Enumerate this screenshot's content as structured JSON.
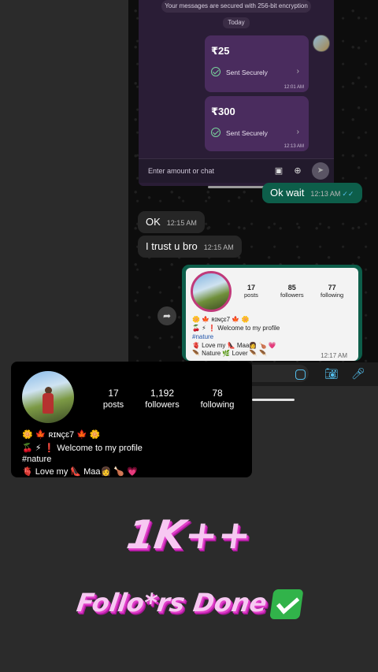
{
  "chat": {
    "encryption_notice": "Your messages are secured with 256-bit encryption",
    "date_label": "Today",
    "payments": [
      {
        "amount": "₹25",
        "status": "Sent Securely",
        "time": "12:01 AM"
      },
      {
        "amount": "₹300",
        "status": "Sent Securely",
        "time": "12:13 AM"
      }
    ],
    "amount_placeholder": "Enter amount or chat",
    "messages": [
      {
        "text": "Ok wait",
        "time": "12:13 AM",
        "direction": "outgoing"
      },
      {
        "text": "OK",
        "time": "12:15 AM",
        "direction": "incoming"
      },
      {
        "text": "I trust u bro",
        "time": "12:15 AM",
        "direction": "incoming"
      }
    ],
    "shared_profile": {
      "posts": "17",
      "posts_label": "posts",
      "followers": "85",
      "followers_label": "followers",
      "following": "77",
      "following_label": "following",
      "bio_line1": "🌼 🍁 ʀɪɴçɛ7 🍁 🌼",
      "bio_line2": "🍒 ⚡ ❗ Welcome to my profile",
      "bio_tag": "#nature",
      "bio_line3": "🫀 Love my 👠 Maa👩 🍗 💗",
      "bio_line4": "🪶 Nature 🌿 Lover 🪶 🪶",
      "time": "12:17 AM"
    }
  },
  "profile": {
    "posts": "17",
    "posts_label": "posts",
    "followers": "1,192",
    "followers_label": "followers",
    "following": "78",
    "following_label": "following",
    "name": "🌼 🍁 ʀɪɴçɛ7 🍁 🌼",
    "bio_line1": "🍒 ⚡ ❗ Welcome to my profile",
    "bio_tag": "#nature",
    "bio_line2": "🫀 Love my 👠 Maa👩 🍗 💗"
  },
  "headline": {
    "line1": "1K++",
    "line2": "Follo*rs Done"
  },
  "colors": {
    "background": "#2b2b2b",
    "payment_sheet": "#2a1d36",
    "outgoing_bubble": "#0d5e4a",
    "incoming_bubble": "#262626",
    "headline_fill": "#f7c8f2",
    "headline_shadow": "#e040c8",
    "check_green": "#31b34a"
  }
}
